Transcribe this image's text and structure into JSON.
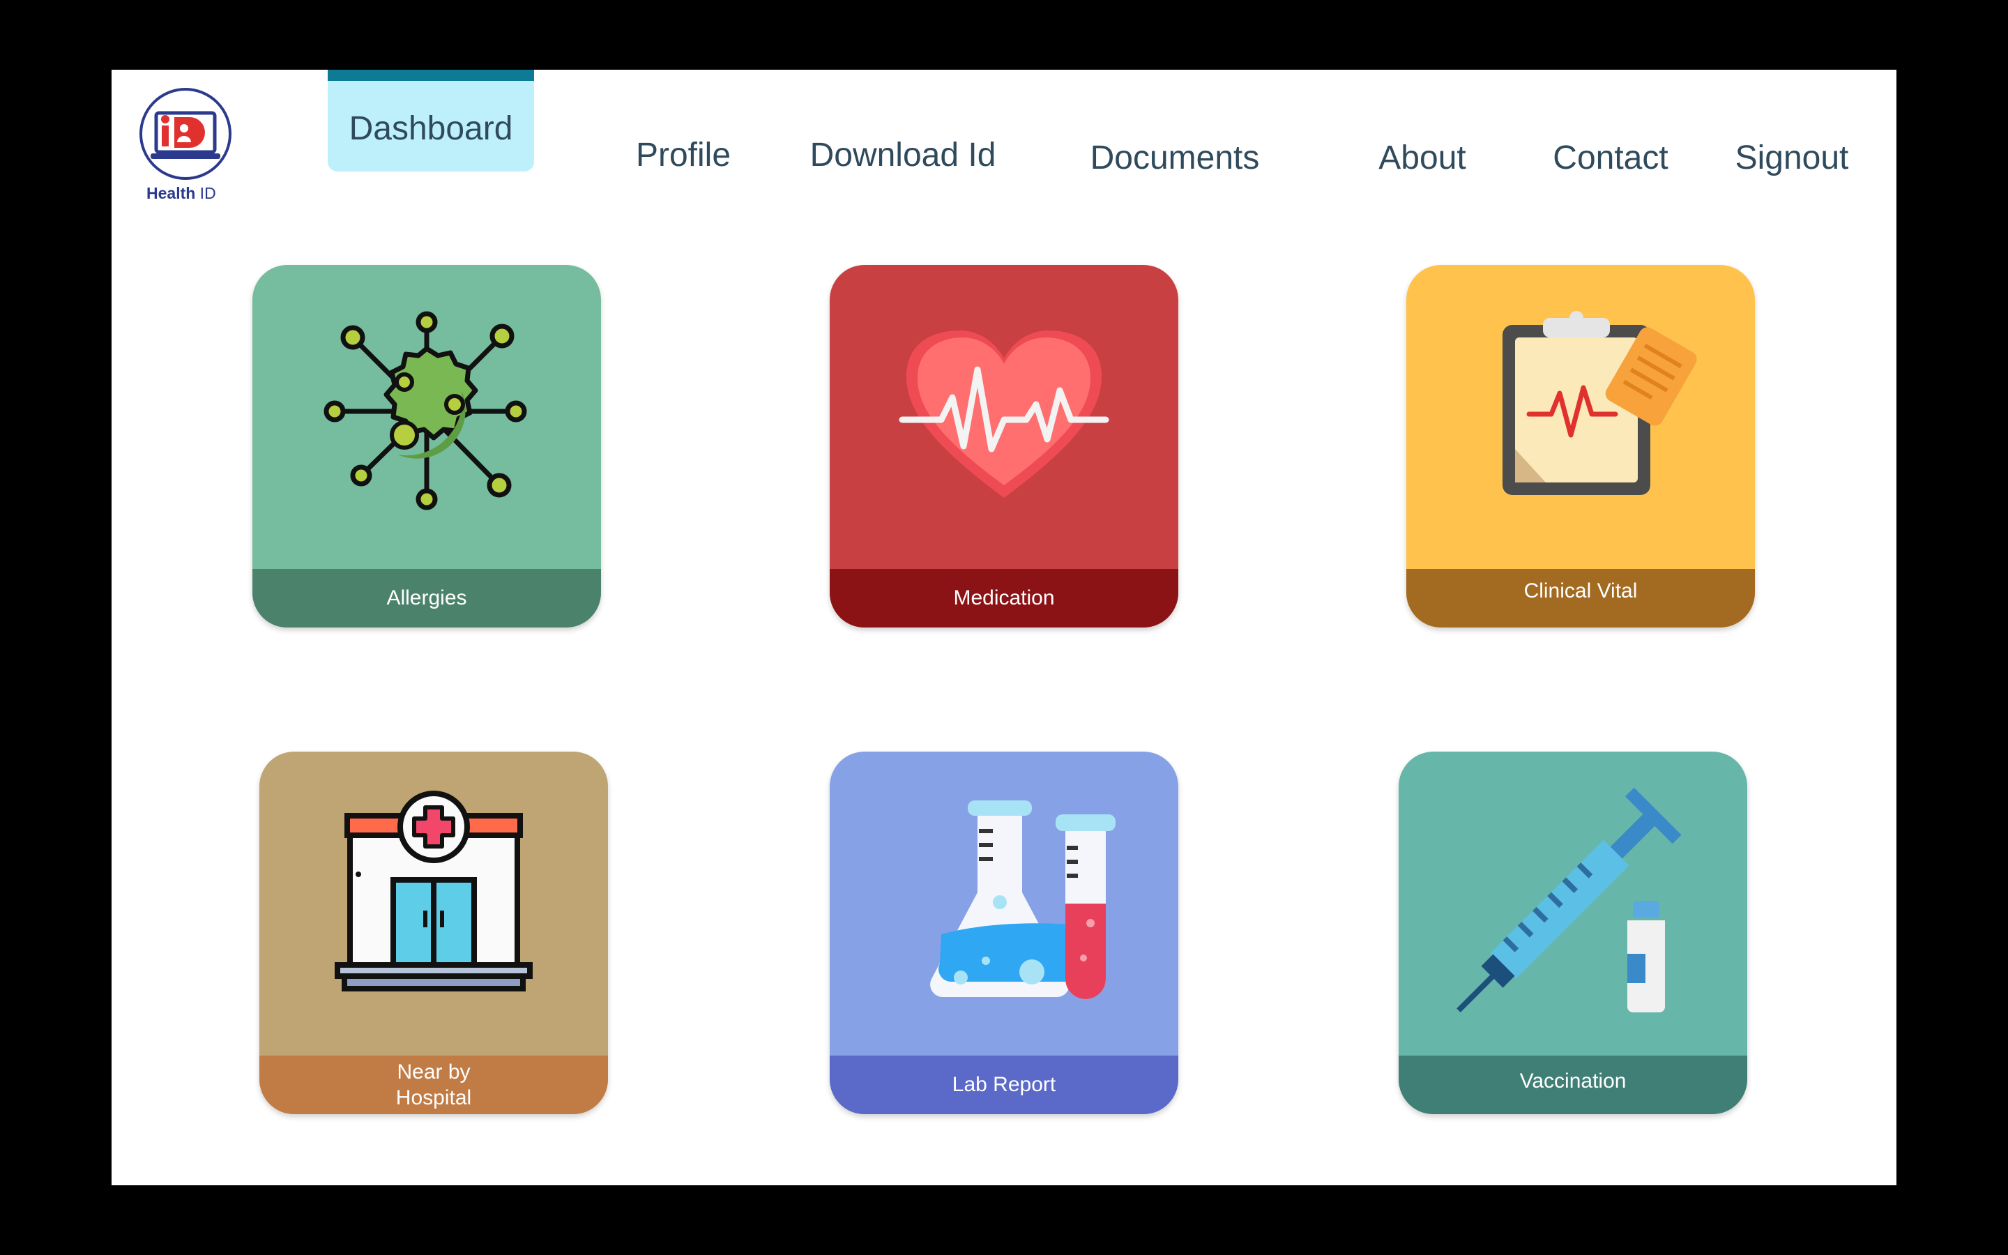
{
  "logo": {
    "brand_bold": "Health",
    "brand_rest": " ID"
  },
  "nav": {
    "dashboard": "Dashboard",
    "profile": "Profile",
    "download_id": "Download Id",
    "documents": "Documents",
    "about": "About",
    "contact": "Contact",
    "signout": "Signout"
  },
  "cards": {
    "allergies": {
      "label": "Allergies",
      "icon": "virus-icon"
    },
    "medication": {
      "label": "Medication",
      "icon": "heart-pulse-icon"
    },
    "clinical_vital": {
      "label": "Clinical Vital",
      "icon": "clipboard-icon"
    },
    "hospital": {
      "label_line1": "Near by",
      "label_line2": "Hospital",
      "icon": "hospital-icon"
    },
    "lab_report": {
      "label": "Lab Report",
      "icon": "flask-icon"
    },
    "vaccination": {
      "label": "Vaccination",
      "icon": "syringe-icon"
    }
  },
  "colors": {
    "nav_active_bg": "#bdf0fb",
    "nav_active_bar": "#0e7b96",
    "allergies": "#76bd9f",
    "medication": "#c94043",
    "clinical_vital": "#ffc34d",
    "hospital": "#bea573",
    "lab_report": "#87a1e6",
    "vaccination": "#67b6aa"
  }
}
